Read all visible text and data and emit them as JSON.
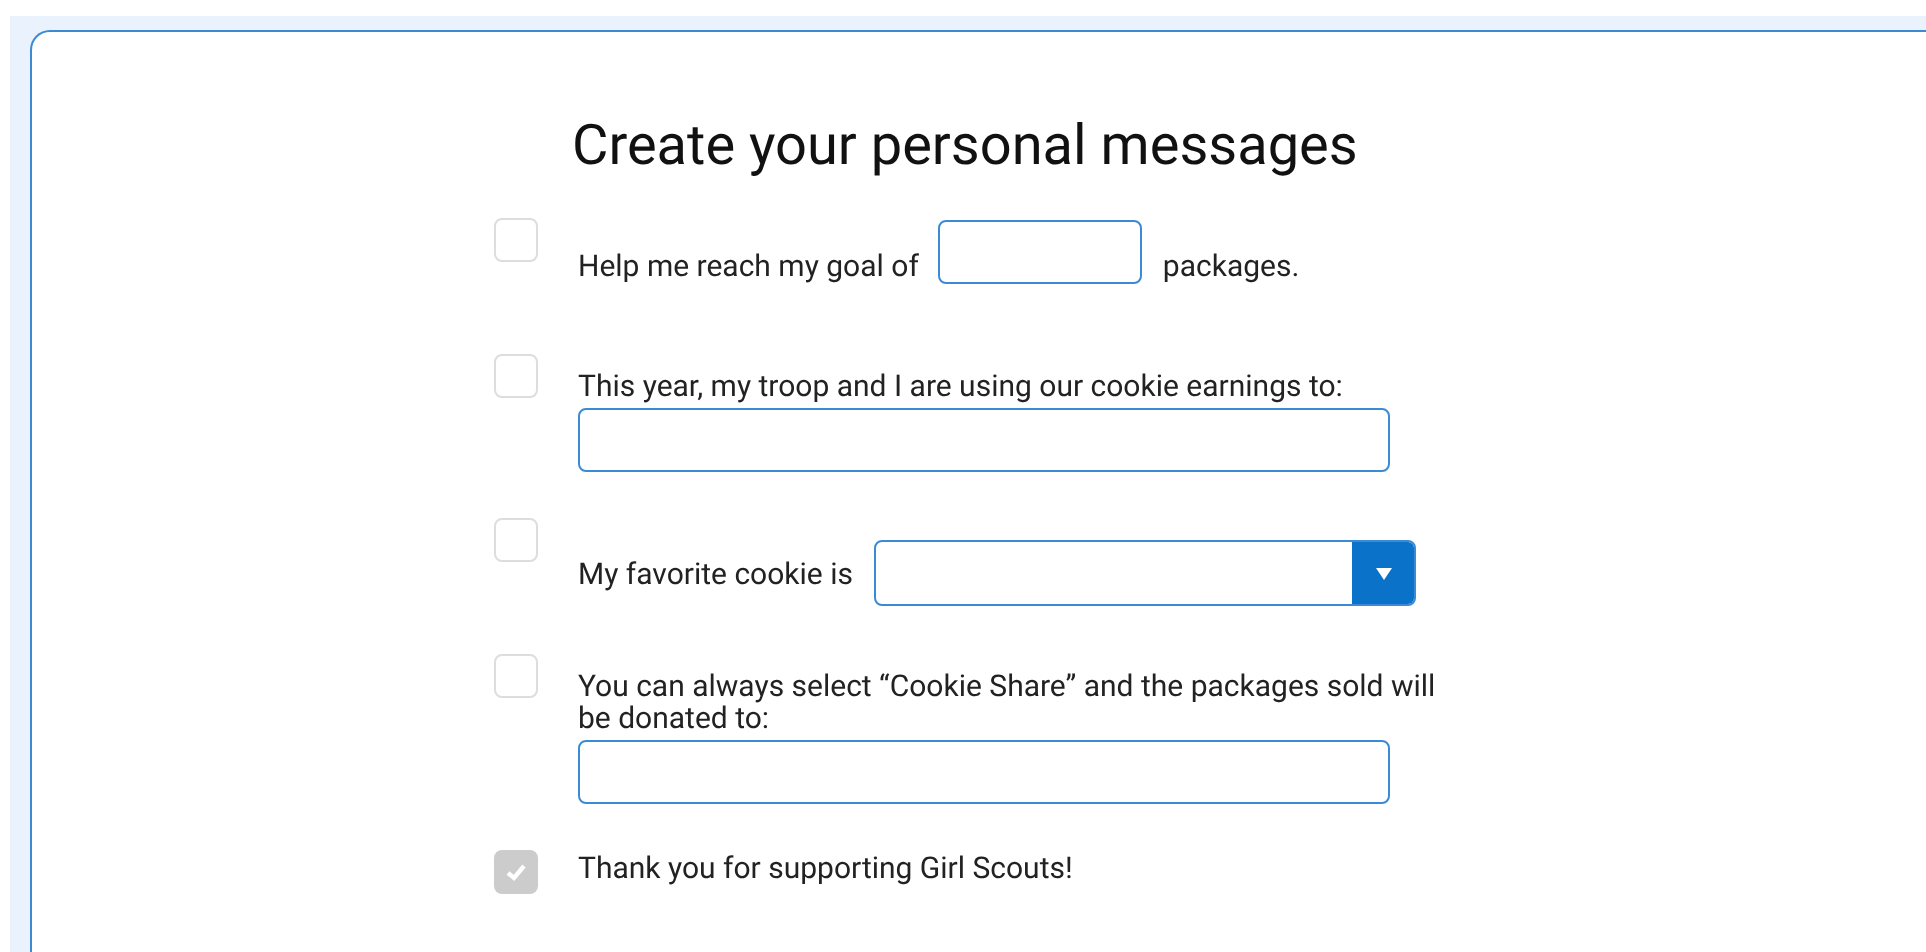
{
  "title": "Create your personal messages",
  "messages": [
    {
      "kind": "inline-field",
      "checked": false,
      "text_before": "Help me reach my goal of",
      "text_after": "packages."
    },
    {
      "kind": "field-below",
      "checked": false,
      "text": "This year, my troop and I are using our cookie earnings to:"
    },
    {
      "kind": "dropdown",
      "checked": false,
      "text": "My favorite cookie is"
    },
    {
      "kind": "field-below",
      "checked": false,
      "text": "You can always select “Cookie Share” and the packages sold will be donated to:"
    },
    {
      "kind": "plain",
      "checked": true,
      "text": "Thank you for supporting Girl Scouts!"
    }
  ]
}
